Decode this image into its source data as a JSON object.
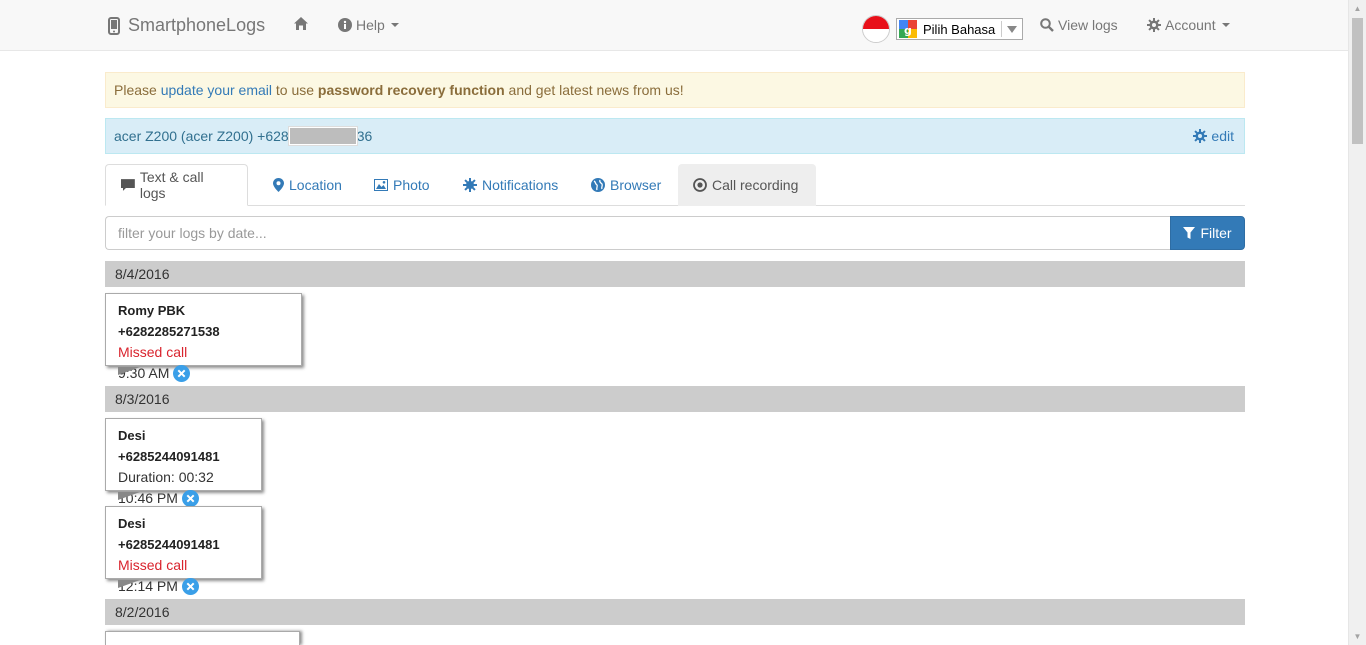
{
  "navbar": {
    "brand": "SmartphoneLogs",
    "help_label": "Help",
    "language_label": "Pilih Bahasa",
    "view_logs_label": "View logs",
    "account_label": "Account"
  },
  "alerts": {
    "warning_prefix": "Please ",
    "warning_link": "update your email",
    "warning_middle": " to use ",
    "warning_bold": "password recovery function",
    "warning_suffix": " and get latest news from us!",
    "device_prefix": "acer Z200 (acer Z200) +628",
    "device_suffix": "36",
    "edit_label": "edit"
  },
  "tabs": [
    {
      "label": "Text & call logs",
      "icon": "comment-icon"
    },
    {
      "label": "Location",
      "icon": "map-marker-icon"
    },
    {
      "label": "Photo",
      "icon": "picture-icon"
    },
    {
      "label": "Notifications",
      "icon": "asterisk-icon"
    },
    {
      "label": "Browser",
      "icon": "globe-icon"
    },
    {
      "label": "Call recording",
      "icon": "record-icon"
    }
  ],
  "filter": {
    "placeholder": "filter your logs by date...",
    "button_label": "Filter"
  },
  "log_groups": [
    {
      "date": "8/4/2016",
      "entries": [
        {
          "contact": "Romy PBK +6282285271538",
          "detail": "Missed call",
          "time": "9:30 AM"
        }
      ]
    },
    {
      "date": "8/3/2016",
      "entries": [
        {
          "contact": "Desi +6285244091481",
          "detail": "Duration: 00:32",
          "time": "10:46 PM"
        },
        {
          "contact": "Desi +6285244091481",
          "detail": "Missed call",
          "time": "12:14 PM"
        }
      ]
    },
    {
      "date": "8/2/2016",
      "entries": []
    }
  ],
  "colors": {
    "link": "#337ab7",
    "missed": "#d9232d",
    "date_bar": "#cccccc",
    "warning_bg": "#fcf8e3",
    "info_bg": "#d9edf7"
  }
}
